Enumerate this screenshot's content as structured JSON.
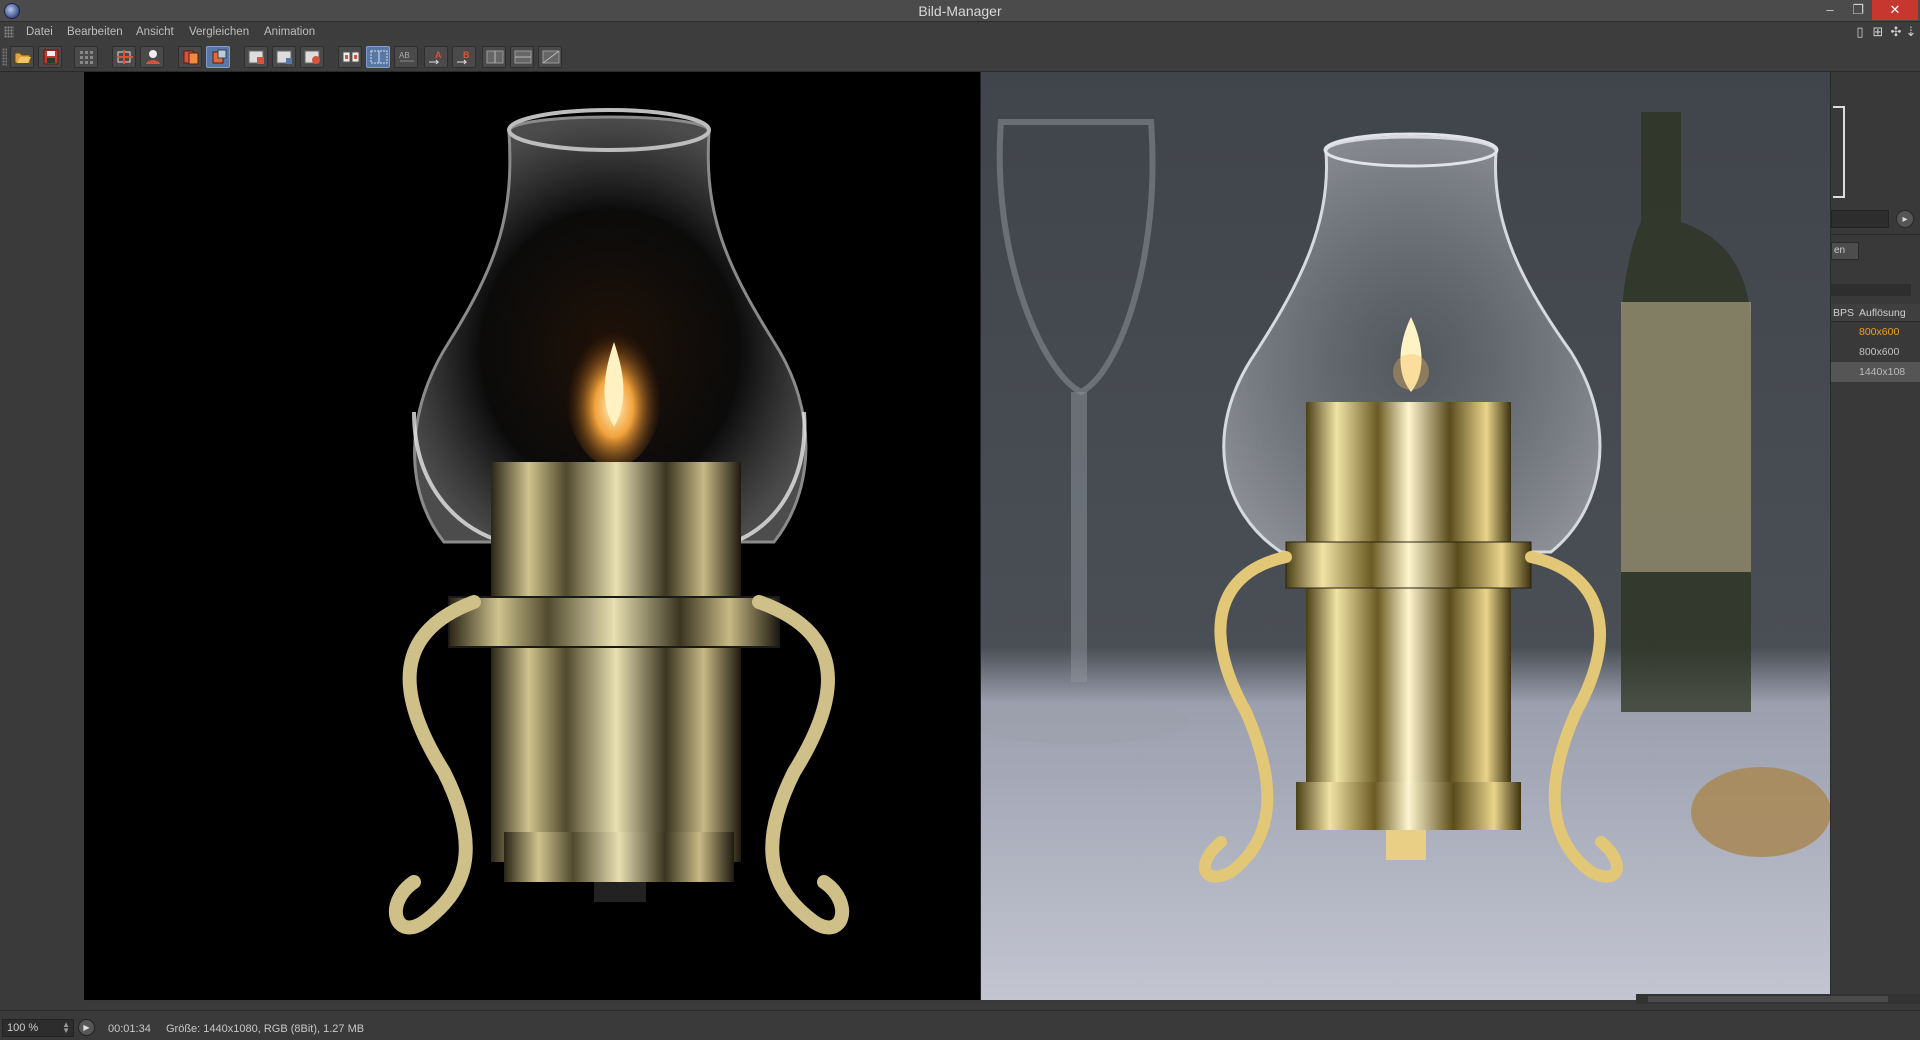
{
  "window": {
    "title": "Bild-Manager",
    "minimize_glyph": "–",
    "maximize_glyph": "❐",
    "close_glyph": "✕"
  },
  "menu": {
    "items": [
      "Datei",
      "Bearbeiten",
      "Ansicht",
      "Vergleichen",
      "Animation"
    ],
    "right_icons": [
      "panel-icon",
      "layout-icon",
      "move-icon"
    ]
  },
  "toolbar": {
    "buttons": [
      "open-icon",
      "save-icon",
      "channel-grid-icon",
      "zoom-fit-icon",
      "user-icon",
      "layers-icon",
      "layer-copy-icon",
      "view-a-icon",
      "view-b-icon",
      "view-ab-icon",
      "compare-icon",
      "compare-active-icon",
      "ab-icon",
      "set-a-icon",
      "set-b-icon",
      "split-h-icon",
      "split-v-icon",
      "split-diag-icon"
    ],
    "active_button": "compare-active-icon"
  },
  "right_panel": {
    "button_label": "en",
    "columns": [
      "BPS",
      "Auflösung"
    ],
    "rows": [
      {
        "resolution": "800x600",
        "state": "selected"
      },
      {
        "resolution": "800x600",
        "state": "normal"
      },
      {
        "resolution": "1440x108",
        "state": "highlight"
      }
    ]
  },
  "status": {
    "zoom": "100 %",
    "time": "00:01:34",
    "info": "Größe: 1440x1080, RGB (8Bit), 1.27 MB"
  },
  "colors": {
    "accent_selected": "#f0a020",
    "active_toolbar": "#5a78a6",
    "close_button": "#c7372f"
  }
}
